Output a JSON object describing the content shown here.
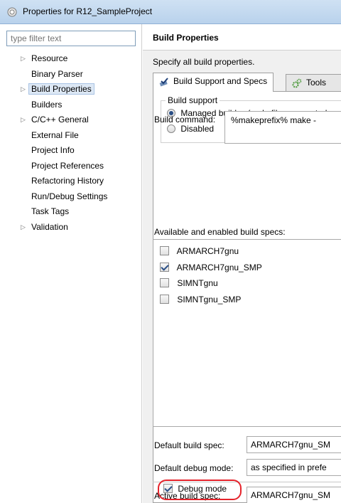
{
  "window": {
    "title": "Properties for R12_SampleProject",
    "icon": "eclipse-gear-icon"
  },
  "left_pane": {
    "filter_placeholder": "type filter text",
    "tree": [
      {
        "label": "Resource",
        "expandable": true,
        "selected": false
      },
      {
        "label": "Binary Parser",
        "expandable": false,
        "selected": false
      },
      {
        "label": "Build Properties",
        "expandable": true,
        "selected": true
      },
      {
        "label": "Builders",
        "expandable": false,
        "selected": false
      },
      {
        "label": "C/C++ General",
        "expandable": true,
        "selected": false
      },
      {
        "label": "External File",
        "expandable": false,
        "selected": false
      },
      {
        "label": "Project Info",
        "expandable": false,
        "selected": false
      },
      {
        "label": "Project References",
        "expandable": false,
        "selected": false
      },
      {
        "label": "Refactoring History",
        "expandable": false,
        "selected": false
      },
      {
        "label": "Run/Debug Settings",
        "expandable": false,
        "selected": false
      },
      {
        "label": "Task Tags",
        "expandable": false,
        "selected": false
      },
      {
        "label": "Validation",
        "expandable": true,
        "selected": false
      }
    ]
  },
  "page": {
    "title": "Build Properties",
    "description": "Specify all build properties.",
    "tabs": [
      {
        "label": "Build Support and Specs",
        "icon": "build-check-icon",
        "active": true
      },
      {
        "label": "Tools",
        "icon": "tools-gear-icon",
        "active": false
      }
    ],
    "build_support": {
      "group_label": "Build support",
      "managed": {
        "label": "Managed build",
        "note": "(makefiles generated",
        "checked": true
      },
      "disabled": {
        "label": "Disabled",
        "checked": false
      }
    },
    "build_command": {
      "label": "Build command:",
      "value": "%makeprefix% make -"
    },
    "specs": {
      "label": "Available and enabled build specs:",
      "items": [
        {
          "label": "ARMARCH7gnu",
          "checked": false
        },
        {
          "label": "ARMARCH7gnu_SMP",
          "checked": true
        },
        {
          "label": "SIMNTgnu",
          "checked": false
        },
        {
          "label": "SIMNTgnu_SMP",
          "checked": false
        }
      ]
    },
    "default_build_spec": {
      "label": "Default build spec:",
      "value": "ARMARCH7gnu_SM"
    },
    "default_debug_mode": {
      "label": "Default debug mode:",
      "value": "as specified in prefe"
    },
    "active_build_spec": {
      "label": "Active build spec:",
      "value": "ARMARCH7gnu_SM"
    },
    "debug_mode": {
      "label": "Debug mode",
      "checked": true
    },
    "highlight_color": "#e5232b"
  }
}
